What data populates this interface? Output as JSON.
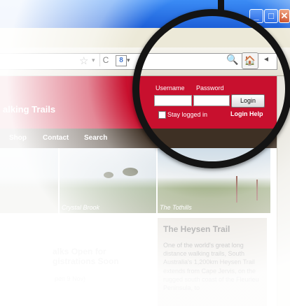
{
  "browser": {
    "window_controls": {
      "minimize": "_",
      "maximize": "□",
      "close": "✕"
    },
    "toolbar_icons": [
      "star-icon",
      "reload-icon",
      "google-icon",
      "search-icon",
      "home-icon",
      "toolbar-extra-icon"
    ],
    "star_glyph": "☆",
    "reload_glyph": "C",
    "google_glyph": "8",
    "dropdown_glyph": "▾",
    "search_glyph": "🔍",
    "home_glyph": "🏠",
    "extra_glyph": "◂",
    "colors": {
      "titlebar": "#1d5fd8",
      "close": "#c9431b"
    }
  },
  "site": {
    "title": "alking Trails",
    "colors": {
      "header": "#c8102e",
      "nav": "#3e3024",
      "sidebox": "#d8d1c6"
    }
  },
  "login": {
    "username_label": "Username",
    "password_label": "Password",
    "login_button": "Login",
    "stay_logged_in": "Stay logged in",
    "help_link": "Login Help"
  },
  "nav": [
    "Shop",
    "Contact",
    "Search"
  ],
  "photos": [
    {
      "caption": ""
    },
    {
      "caption": "Crystal Brook"
    },
    {
      "caption": "The Tothills"
    }
  ],
  "news": {
    "headline": "alks Open for\ngistrations Soon",
    "meta": "pen 9 Nov)"
  },
  "sidebar": {
    "title": "The Heysen Trail",
    "text": "One of the world's great long distance walking trails, South Australia's 1,200km Heysen Trail extends from Cape Jervis, on the rugged south coast of the Fleurieu Peninsula, to"
  }
}
